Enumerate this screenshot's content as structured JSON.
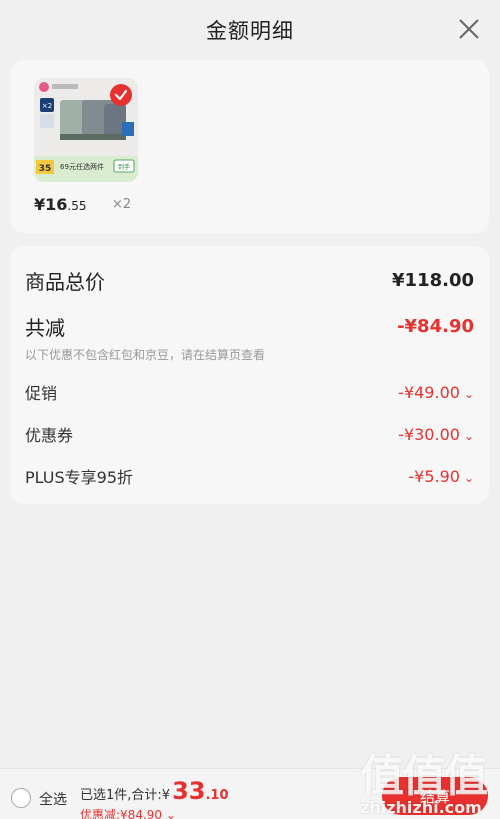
{
  "header": {
    "title": "金额明细"
  },
  "product": {
    "price_main": "¥16",
    "price_cents": ".55",
    "quantity": "×2",
    "promo_badge_count": "×2",
    "promo_price": "35",
    "promo_text": "69元任选两件",
    "promo_tag": "到手"
  },
  "summary": {
    "total_label": "商品总价",
    "total_value": "¥118.00",
    "reduce_label": "共减",
    "reduce_value": "-¥84.90",
    "note": "以下优惠不包含红包和京豆，请在结算页查看",
    "items": [
      {
        "label": "促销",
        "value": "-¥49.00"
      },
      {
        "label": "优惠券",
        "value": "-¥30.00"
      },
      {
        "label": "PLUS专享95折",
        "value": "-¥5.90"
      }
    ]
  },
  "footer": {
    "select_all": "全选",
    "selected_text": "已选1件,合计:¥",
    "total_main": "33",
    "total_cents": ".10",
    "discount_text": "优惠减:¥84.90",
    "checkout": "结算"
  },
  "watermark": {
    "glyphs": "值值值",
    "site": "zhizhizhi.com"
  },
  "colors": {
    "accent": "#e8312f",
    "background": "#f0f0f0",
    "card": "#f7f7f7"
  }
}
